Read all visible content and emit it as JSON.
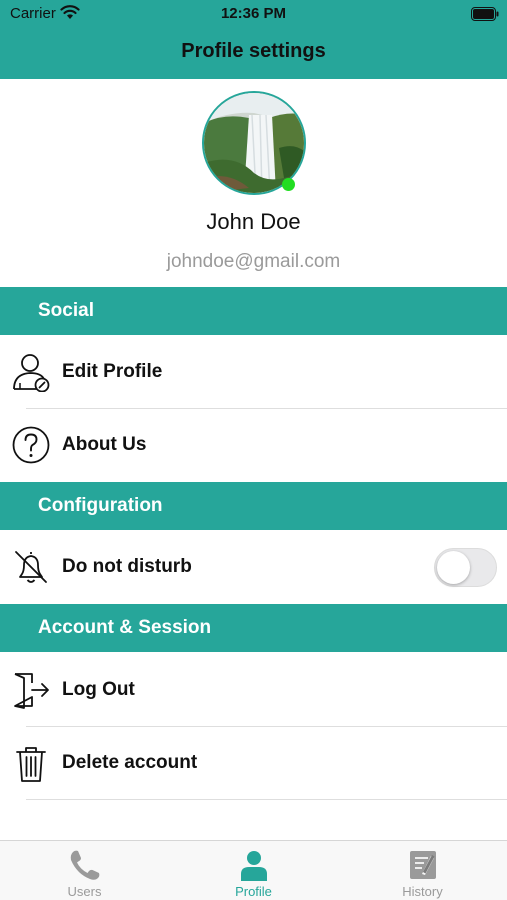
{
  "status_bar": {
    "carrier": "Carrier",
    "time": "12:36 PM"
  },
  "header": {
    "title": "Profile settings"
  },
  "profile": {
    "name": "John Doe",
    "email": "johndoe@gmail.com",
    "online": true
  },
  "sections": {
    "social": {
      "title": "Social",
      "items": [
        {
          "label": "Edit Profile",
          "icon": "edit-profile-icon"
        },
        {
          "label": "About Us",
          "icon": "help-icon"
        }
      ]
    },
    "configuration": {
      "title": "Configuration",
      "items": [
        {
          "label": "Do not disturb",
          "icon": "bell-off-icon",
          "toggle": false
        }
      ]
    },
    "account": {
      "title": "Account & Session",
      "items": [
        {
          "label": "Log Out",
          "icon": "logout-icon"
        },
        {
          "label": "Delete account",
          "icon": "trash-icon"
        }
      ]
    }
  },
  "tabs": [
    {
      "label": "Users",
      "icon": "phone-icon",
      "active": false
    },
    {
      "label": "Profile",
      "icon": "person-icon",
      "active": true
    },
    {
      "label": "History",
      "icon": "history-icon",
      "active": false
    }
  ],
  "colors": {
    "accent": "#26a69a",
    "online": "#22dd22",
    "muted": "#9a9a9a"
  }
}
